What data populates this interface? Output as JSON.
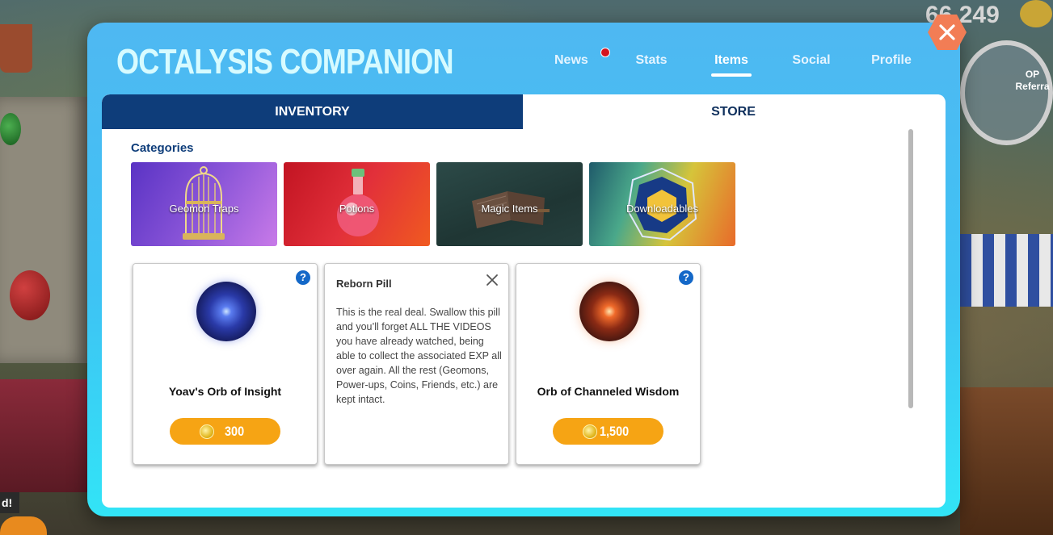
{
  "background": {
    "score": "66,249",
    "side_label_left": "d!",
    "side_label_right": "OP Referra"
  },
  "modal": {
    "title": "OCTALYSIS COMPANION",
    "nav": [
      {
        "label": "News",
        "has_notification": true
      },
      {
        "label": "Stats"
      },
      {
        "label": "Items",
        "active": true
      },
      {
        "label": "Social"
      },
      {
        "label": "Profile"
      }
    ],
    "close_icon": "close-icon"
  },
  "tabs": {
    "inventory": "INVENTORY",
    "store": "STORE",
    "active": "inventory"
  },
  "categories": {
    "heading": "Categories",
    "items": [
      {
        "label": "Geomon Traps",
        "icon": "birdcage-icon"
      },
      {
        "label": "Potions",
        "icon": "potion-flask-icon"
      },
      {
        "label": "Magic Items",
        "icon": "open-book-icon"
      },
      {
        "label": "Downloadables",
        "icon": "octalysis-hexagon-icon"
      }
    ]
  },
  "items": [
    {
      "name": "Yoav's Orb of Insight",
      "price": "300",
      "icon": "blue-orb-icon",
      "currency_icon": "coin-icon"
    },
    {
      "name": "Reborn Pill",
      "description": "This is the real deal. Swallow this pill and you’ll forget ALL THE VIDEOS you have already watched, being able to collect the associated EXP all over again. All the rest (Geomons, Power-ups, Coins, Friends, etc.) are kept intact."
    },
    {
      "name": "Orb of Channeled Wisdom",
      "price": "1,500",
      "icon": "red-orb-icon",
      "currency_icon": "coin-icon"
    }
  ],
  "colors": {
    "accent_blue": "#0e3d7a",
    "modal_cyan": "#3ec3f4",
    "price_orange": "#f6a414",
    "close_orange": "#f27d55",
    "notification_red": "#d4141f"
  }
}
